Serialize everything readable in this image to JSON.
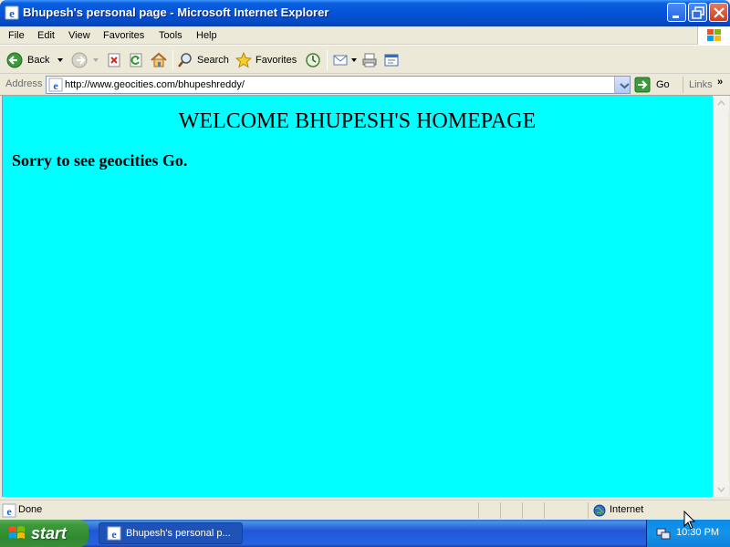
{
  "window": {
    "title": "Bhupesh's personal page - Microsoft Internet Explorer"
  },
  "menu": {
    "items": [
      "File",
      "Edit",
      "View",
      "Favorites",
      "Tools",
      "Help"
    ]
  },
  "toolbar": {
    "back_label": "Back",
    "search_label": "Search",
    "favorites_label": "Favorites"
  },
  "address": {
    "label": "Address",
    "url": "http://www.geocities.com/bhupeshreddy/",
    "go_label": "Go",
    "links_label": "Links"
  },
  "page": {
    "heading": "WELCOME BHUPESH'S HOMEPAGE",
    "text": "Sorry to see geocities Go.",
    "background": "#00ffff"
  },
  "status": {
    "text": "Done",
    "zone": "Internet"
  },
  "taskbar": {
    "start_label": "start",
    "task_label": "Bhupesh's personal p...",
    "clock": "10:30 PM"
  },
  "icons": {
    "title": "ie-icon",
    "back": "back-arrow-icon",
    "forward": "forward-arrow-icon",
    "stop": "stop-icon",
    "refresh": "refresh-icon",
    "home": "home-icon",
    "search": "search-icon",
    "favorites": "star-icon",
    "history": "history-icon",
    "mail": "mail-icon",
    "print": "print-icon",
    "edit": "edit-icon",
    "go": "go-arrow-icon"
  }
}
